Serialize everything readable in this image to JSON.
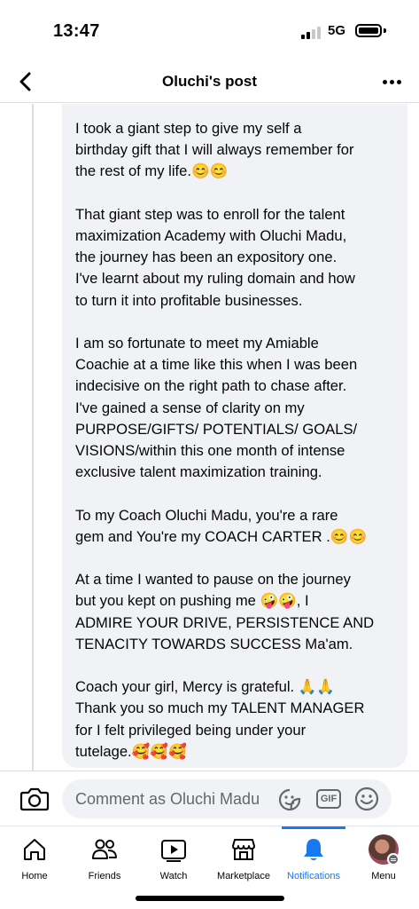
{
  "status_bar": {
    "time": "13:47",
    "network": "5G",
    "icons": [
      "signal-bars-icon",
      "battery-icon"
    ]
  },
  "header": {
    "title": "Oluchi's post",
    "back_icon": "chevron-left-icon",
    "more_icon": "ellipsis-icon"
  },
  "post": {
    "paragraphs": [
      " I took a giant step to give my self a\nbirthday gift that I will always remember for\nthe rest of my life.😊😊",
      "That giant step was to enroll for the talent\nmaximization Academy with Oluchi Madu,\nthe journey has been an expository one.\nI've learnt about my ruling domain and how\nto turn it into profitable businesses.",
      "I am so fortunate to meet my Amiable\nCoachie at a time like this when I was been\nindecisive on the right path to chase after.\nI've gained a sense of clarity on my\nPURPOSE/GIFTS/ POTENTIALS/ GOALS/\nVISIONS/within this one month of intense\nexclusive talent maximization training.",
      "To my Coach Oluchi Madu, you're a rare\ngem and You're my COACH CARTER .😊😊",
      "At a time  I wanted to pause on the journey\nbut you kept on pushing me 🤪🤪, I\nADMIRE YOUR DRIVE,  PERSISTENCE AND\nTENACITY TOWARDS SUCCESS Ma'am.",
      "Coach your girl, Mercy is grateful. 🙏🙏\nThank you so much my TALENT MANAGER\nfor I felt privileged being under your\ntutelage.🥰🥰🥰"
    ]
  },
  "comment_bar": {
    "placeholder": "Comment as Oluchi Madu",
    "gif_label": "GIF",
    "icons": [
      "camera-icon",
      "sticker-icon",
      "gif-icon",
      "emoji-icon"
    ]
  },
  "bottom_nav": {
    "active": "Notifications",
    "active_color": "#1877f2",
    "items": [
      {
        "label": "Home",
        "icon": "home-icon"
      },
      {
        "label": "Friends",
        "icon": "friends-icon"
      },
      {
        "label": "Watch",
        "icon": "watch-icon"
      },
      {
        "label": "Marketplace",
        "icon": "marketplace-icon"
      },
      {
        "label": "Notifications",
        "icon": "bell-icon"
      },
      {
        "label": "Menu",
        "icon": "avatar"
      }
    ]
  }
}
